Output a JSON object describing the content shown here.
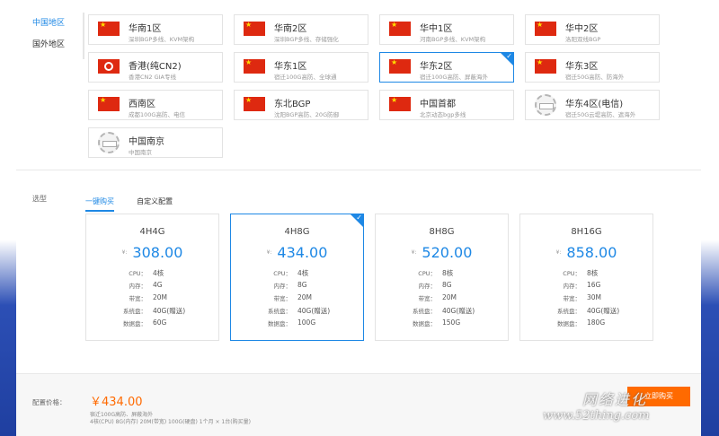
{
  "region_tabs": [
    {
      "label": "中国地区",
      "active": true
    },
    {
      "label": "国外地区",
      "active": false
    }
  ],
  "regions": [
    {
      "name": "华南1区",
      "desc": "深圳BGP多线、KVM架构",
      "icon": "china-flag-icon"
    },
    {
      "name": "华南2区",
      "desc": "深圳BGP多线、存储强化",
      "icon": "china-flag-icon"
    },
    {
      "name": "华中1区",
      "desc": "河南BGP多线、KVM架构",
      "icon": "china-flag-icon"
    },
    {
      "name": "华中2区",
      "desc": "洛阳双线BGP",
      "icon": "china-flag-icon"
    },
    {
      "name": "香港(纯CN2)",
      "desc": "香港CN2 GIA专线",
      "icon": "hong-kong-flag-icon"
    },
    {
      "name": "华东1区",
      "desc": "宿迁100G高防、全球通",
      "icon": "china-flag-icon"
    },
    {
      "name": "华东2区",
      "desc": "宿迁100G高防、屏蔽海外",
      "icon": "china-flag-icon",
      "selected": true
    },
    {
      "name": "华东3区",
      "desc": "宿迁50G高防、防海外",
      "icon": "china-flag-icon"
    },
    {
      "name": "西南区",
      "desc": "成都100G高防、电信",
      "icon": "china-flag-icon"
    },
    {
      "name": "东北BGP",
      "desc": "沈阳BGP高防、20G防御",
      "icon": "china-flag-icon"
    },
    {
      "name": "中国首都",
      "desc": "北京动态bgp多线",
      "icon": "china-flag-icon"
    },
    {
      "name": "华东4区(电信)",
      "desc": "宿迁50G云堤高防、遮海外",
      "icon": "stamp-icon"
    },
    {
      "name": "中国南京",
      "desc": "中国南京",
      "icon": "stamp-icon"
    }
  ],
  "model": {
    "label": "选型",
    "tabs": [
      {
        "label": "一键购买",
        "active": true
      },
      {
        "label": "自定义配置",
        "active": false
      }
    ]
  },
  "plans": [
    {
      "title": "4H4G",
      "currency": "¥:",
      "price": "308.00",
      "cpu_k": "CPU：",
      "cpu": "4核",
      "mem_k": "内存：",
      "mem": "4G",
      "bw_k": "带宽：",
      "bw": "20M",
      "sys_k": "系统盘：",
      "sys": "40G(赠送)",
      "data_k": "数据盘：",
      "data": "60G",
      "selected": false
    },
    {
      "title": "4H8G",
      "currency": "¥:",
      "price": "434.00",
      "cpu_k": "CPU：",
      "cpu": "4核",
      "mem_k": "内存：",
      "mem": "8G",
      "bw_k": "带宽：",
      "bw": "20M",
      "sys_k": "系统盘：",
      "sys": "40G(赠送)",
      "data_k": "数据盘：",
      "data": "100G",
      "selected": true
    },
    {
      "title": "8H8G",
      "currency": "¥:",
      "price": "520.00",
      "cpu_k": "CPU：",
      "cpu": "8核",
      "mem_k": "内存：",
      "mem": "8G",
      "bw_k": "带宽：",
      "bw": "20M",
      "sys_k": "系统盘：",
      "sys": "40G(赠送)",
      "data_k": "数据盘：",
      "data": "150G",
      "selected": false
    },
    {
      "title": "8H16G",
      "currency": "¥:",
      "price": "858.00",
      "cpu_k": "CPU：",
      "cpu": "8核",
      "mem_k": "内存：",
      "mem": "16G",
      "bw_k": "带宽：",
      "bw": "30M",
      "sys_k": "系统盘：",
      "sys": "40G(赠送)",
      "data_k": "数据盘：",
      "data": "180G",
      "selected": false
    }
  ],
  "footer": {
    "price_label": "配置价格：",
    "total": "￥434.00",
    "note1": "宿迁100G高防、屏蔽海外",
    "note2": "4核(CPU) 8G(内存) 20M(带宽) 100G(硬盘) 1个月 × 1台(购买量)",
    "buy_label": "立即购买"
  },
  "watermark": {
    "cn": "网络进化",
    "url": "www.52thing.com"
  },
  "colors": {
    "accent": "#1e88e5",
    "price_orange": "#ff6a00",
    "side_blue": "#2c4fb5"
  }
}
